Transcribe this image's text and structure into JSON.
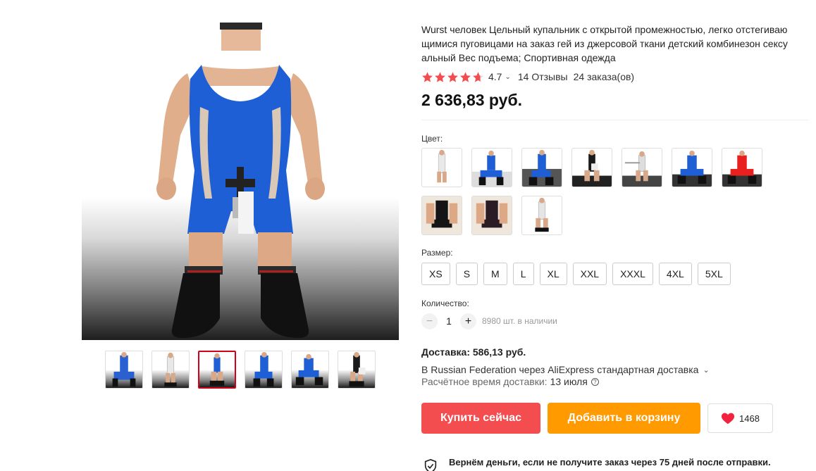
{
  "product": {
    "title": "Wurst человек Цельный купальник с открытой промежностью, легко отстегиваю щимися пуговицами на заказ гей из джерсовой ткани детский комбинезон сексу альный Вес подъема; Спортивная одежда",
    "rating": {
      "value": "4.7",
      "stars": 4.7,
      "reviews": "14 Отзывы",
      "orders": "24 заказа(ов)"
    },
    "price": "2 636,83 руб."
  },
  "gallery": {
    "main_image": "blue wrestling singlet photo",
    "thumbnail_count": 6,
    "active_thumbnail": 3
  },
  "options": {
    "color_label": "Цвет:",
    "color_swatch_count": 10,
    "size_label": "Размер:",
    "sizes": [
      "XS",
      "S",
      "M",
      "L",
      "XL",
      "XXL",
      "XXXL",
      "4XL",
      "5XL"
    ],
    "quantity_label": "Количество:",
    "quantity": "1",
    "stock": "8980 шт. в наличии"
  },
  "delivery": {
    "cost": "Доставка: 586,13 руб.",
    "method": "В Russian Federation через AliExpress стандартная доставка",
    "time_label": "Расчётное время доставки:",
    "date": "13 июля"
  },
  "buttons": {
    "buy_now": "Купить сейчас",
    "add_to_cart": "Добавить в корзину",
    "wishlist_count": "1468"
  },
  "guarantee": {
    "text": "Вернём деньги, если не получите заказ через 75 дней после отправки."
  },
  "icons": {
    "star": "star-icon",
    "heart": "heart-icon",
    "shield": "shield-check-icon",
    "help": "question-circle-icon",
    "chevron": "chevron-down-icon"
  },
  "colors": {
    "star": "#f34d50",
    "buy_button": "#f34d50",
    "cart_button": "#ff9a00",
    "active_thumb_border": "#d0021b",
    "heart": "#f2233f"
  }
}
